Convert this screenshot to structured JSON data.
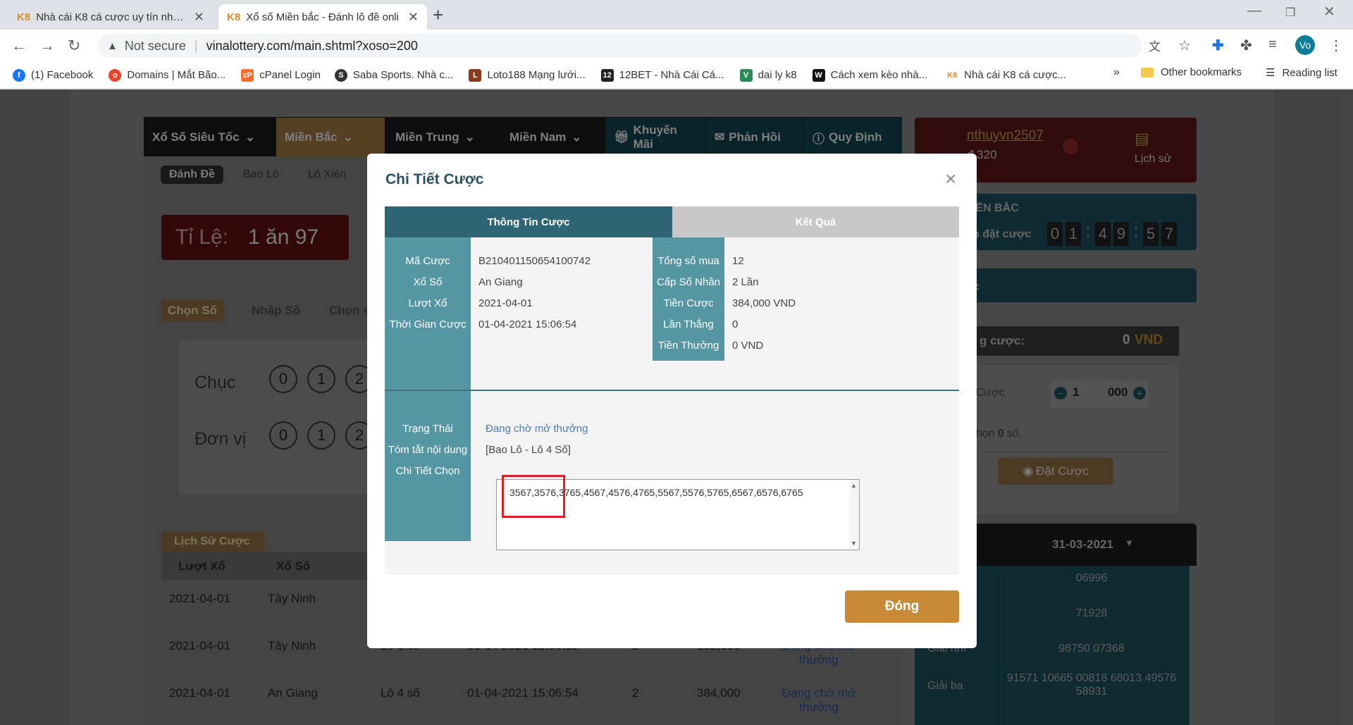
{
  "browser": {
    "tabs": [
      {
        "favicon": "K8",
        "title": "Nhà cái K8 cá cược uy tín nhất nă"
      },
      {
        "favicon": "K8",
        "title": "Xổ số Miền bắc - Đánh lô đề onli"
      }
    ],
    "new_tab": "+",
    "not_secure": "Not secure",
    "url": "vinalottery.com/main.shtml?xoso=200",
    "profile_initial": "Vo",
    "bookmarks": [
      {
        "label": "(1) Facebook",
        "icon": "facebook-icon",
        "color": "#1877f2"
      },
      {
        "label": "Domains | Mắt Bão...",
        "icon": "matbao-icon",
        "color": "#e8452c"
      },
      {
        "label": "cPanel Login",
        "icon": "cpanel-icon",
        "color": "#ff6c2c"
      },
      {
        "label": "Saba Sports. Nhà c...",
        "icon": "saba-icon",
        "color": "#333333"
      },
      {
        "label": "Loto188 Mạng lưới...",
        "icon": "loto188-icon",
        "color": "#8b3a1a"
      },
      {
        "label": "12BET - Nhà Cái Cá...",
        "icon": "12bet-icon",
        "color": "#222222"
      },
      {
        "label": "dai ly k8",
        "icon": "vue-icon",
        "color": "#2a8a5a"
      },
      {
        "label": "Cách xem kèo nhà...",
        "icon": "w-icon",
        "color": "#111111"
      },
      {
        "label": "Nhà cái K8 cá cược...",
        "icon": "k8-icon",
        "color": "#e08b2b"
      }
    ],
    "more": "»",
    "other_bookmarks": "Other bookmarks",
    "reading_list": "Reading list"
  },
  "site": {
    "nav": [
      "Xổ Số Siêu Tốc",
      "Miền Bắc",
      "Miền Trung",
      "Miền Nam",
      "Khuyến Mãi",
      "Phản Hồi",
      "Quy Định"
    ],
    "subtabs": [
      "Đánh Đề",
      "Bao Lô",
      "Lô Xiên"
    ],
    "ratio_label": "Tỉ Lệ:",
    "ratio_value": "1 ăn 97",
    "pick_tabs": [
      "Chọn Số",
      "Nhập Số",
      "Chọn s"
    ],
    "chuc": "Chục",
    "don_vi": "Đơn vị",
    "digits": [
      "0",
      "1",
      "2"
    ],
    "history_title": "Lịch Sử Cược",
    "history_cols": [
      "Lượt Xổ",
      "Xổ Số"
    ],
    "history_rows": [
      {
        "date": "2021-04-01",
        "lottery": "Tây Ninh",
        "type": "",
        "time": "",
        "qty": "",
        "amount": "",
        "status": ""
      },
      {
        "date": "2021-04-01",
        "lottery": "Tây Ninh",
        "type": "Lô 3 số",
        "time": "01-04-2021 15:06:11",
        "qty": "2",
        "amount": "192,000",
        "status": "Đang chờ mở thưởng"
      },
      {
        "date": "2021-04-01",
        "lottery": "An Giang",
        "type": "Lô 4 số",
        "time": "01-04-2021 15:06:54",
        "qty": "2",
        "amount": "384,000",
        "status": "Đang chờ mở thưởng"
      }
    ],
    "user": {
      "name": "nthuyvn2507",
      "balance": "đ 320",
      "history": "Lịch sử"
    },
    "region": "IỀN BẮC",
    "deadline_label": "n đặt cược",
    "countdown": [
      "0",
      "1",
      ":",
      "4",
      "9",
      ":",
      "5",
      "7"
    ],
    "cuoc_label": "c",
    "total_label": "g cược:",
    "total_value": "0",
    "total_currency": "VND",
    "stake_label": "Cược",
    "stake_mult": "1",
    "stake_unit": "000",
    "chosen_prefix": "họn",
    "chosen_count": "0",
    "chosen_suffix": "số.",
    "bet_button": "Đặt Cược",
    "results_date": "31-03-2021",
    "results": [
      {
        "label": "",
        "value": "06996"
      },
      {
        "label": "",
        "value": "71928"
      },
      {
        "label": "Giải nhì",
        "value": "98750 07368"
      },
      {
        "label": "Giải ba",
        "value": "91571 10665 00818 68013 49576 58931"
      }
    ]
  },
  "modal": {
    "title": "Chi Tiết Cược",
    "close_icon": "×",
    "tab_info": "Thông Tin Cược",
    "tab_result": "Kết Quả",
    "left_fields": [
      {
        "label": "Mã Cược",
        "value": "B210401150654100742"
      },
      {
        "label": "Xổ Số",
        "value": "An Giang"
      },
      {
        "label": "Lượt Xổ",
        "value": "2021-04-01"
      },
      {
        "label": "Thời Gian Cược",
        "value": "01-04-2021 15:06:54"
      }
    ],
    "right_fields": [
      {
        "label": "Tổng số mua",
        "value": "12"
      },
      {
        "label": "Cấp Số Nhân",
        "value": "2 Lần"
      },
      {
        "label": "Tiền Cược",
        "value": "384,000 VND"
      },
      {
        "label": "Lần Thắng",
        "value": "0"
      },
      {
        "label": "Tiền Thưởng",
        "value": "0 VND"
      }
    ],
    "status_label": "Trạng Thái",
    "status_value": "Đang chờ mở thưởng",
    "summary_label": "Tóm tắt nội dung",
    "summary_value": "[Bao Lô - Lô 4 Số]",
    "detail_label": "Chi Tiết Chọn",
    "detail_value": "3567,3576,3765,4567,4576,4765,5567,5576,5765,6567,6576,6765",
    "close_button": "Đóng"
  },
  "colors": {
    "accent_gold": "#c98a37",
    "teal": "#2e6473",
    "label_teal": "#5596a3",
    "highlight_red": "#e02020"
  }
}
